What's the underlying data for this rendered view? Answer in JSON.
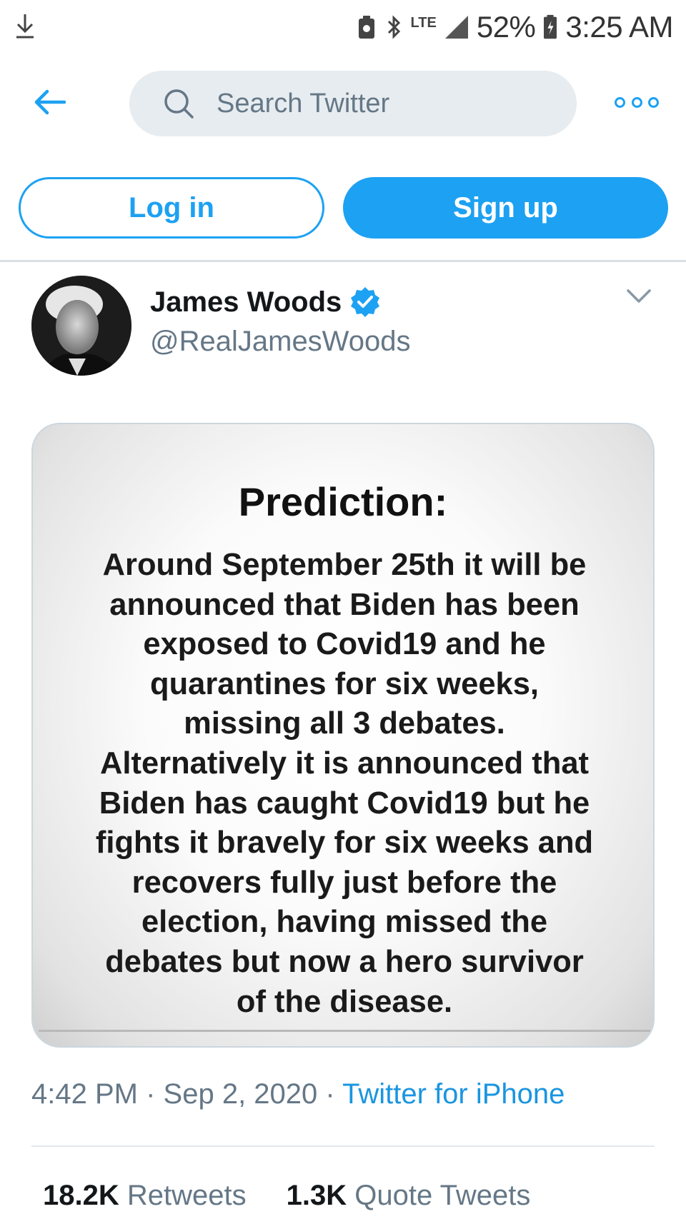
{
  "status_bar": {
    "network": "LTE",
    "battery": "52%",
    "time": "3:25 AM"
  },
  "header": {
    "search_placeholder": "Search Twitter"
  },
  "auth": {
    "login_label": "Log in",
    "signup_label": "Sign up"
  },
  "tweet": {
    "author_name": "James Woods",
    "author_handle": "@RealJamesWoods",
    "media": {
      "title": "Prediction:",
      "body_lines": [
        "Around September 25th it will be",
        "announced that Biden has been",
        "exposed to Covid19 and he",
        "quarantines for six weeks,",
        "missing all 3 debates.",
        "Alternatively it is announced that",
        "Biden has caught Covid19 but he",
        "fights it bravely for six weeks and",
        "recovers fully just before the",
        "election, having missed the",
        "debates but now a hero survivor",
        "of the disease."
      ]
    },
    "time": "4:42 PM",
    "date": "Sep 2, 2020",
    "separator": "·",
    "source": "Twitter for iPhone",
    "stats": {
      "retweets_count": "18.2K",
      "retweets_label": "Retweets",
      "quotes_count": "1.3K",
      "quotes_label": "Quote Tweets"
    }
  },
  "colors": {
    "accent": "#1da1f2",
    "secondary_text": "#657786",
    "search_bg": "#e6ecf0"
  }
}
